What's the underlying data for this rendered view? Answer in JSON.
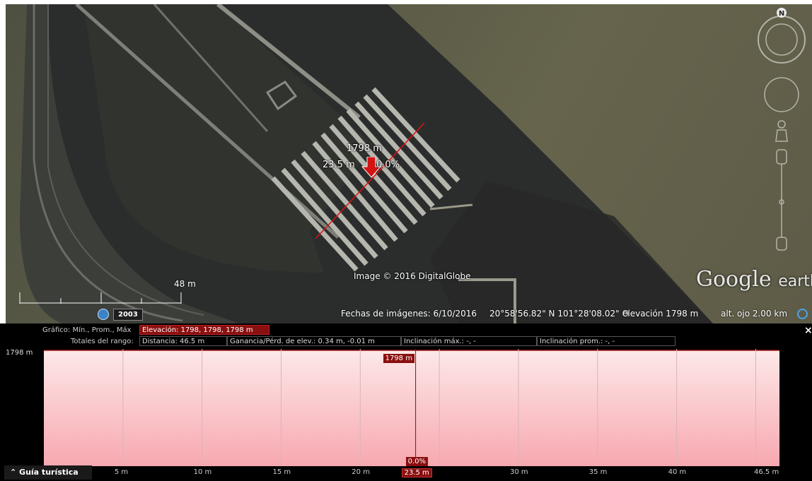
{
  "map": {
    "elevation_marker": "1798 m",
    "distance_marker": "23.5 m",
    "slope_marker": "0.0%",
    "image_credit": "Image © 2016 DigitalGlobe",
    "scale_label": "48 m",
    "history_year": "2003",
    "imagery_date": "Fechas de imágenes: 6/10/2016",
    "coordinates": "20°58'56.82\" N 101°28'08.02\" O",
    "elevation": "elevación  1798 m",
    "eye_alt": "alt. ojo   2.00 km",
    "logo_main": "Google",
    "logo_sub": "earth",
    "compass_north": "N",
    "colors": {
      "path_line": "#e01010",
      "marker_arrow": "#d41414"
    }
  },
  "profile": {
    "graph_label": "Gráfico: Mín., Prom., Máx",
    "elevation_summary": "Elevación: 1798, 1798, 1798 m",
    "range_totals_label": "Totales del rango:",
    "distance": "Distancia: 46.5 m",
    "gain_loss": "Ganancia/Pérd. de elev.: 0.34 m, -0.01 m",
    "max_slope": "Inclinación máx.: -, -",
    "avg_slope": "Inclinación prom.: -, -",
    "y_label": "1798 m",
    "cursor_elevation": "1798 m",
    "cursor_slope": "0.0%",
    "cursor_distance": "23.5 m",
    "close_label": "×",
    "tour_guide": "⌃ Guía turística",
    "colors": {
      "fill_top": "#fde8e8",
      "fill_bottom": "#f7a8b0",
      "line": "#a01818",
      "tag_bg": "#8a0f0f"
    }
  },
  "chart_data": {
    "type": "area",
    "x_ticks": [
      "5 m",
      "10 m",
      "15 m",
      "20 m",
      "30 m",
      "35 m",
      "40 m",
      "46.5 m"
    ],
    "x": [
      0,
      46.5
    ],
    "y": [
      1798,
      1798
    ],
    "xlim": [
      0,
      46.5
    ],
    "cursor_x": 23.5,
    "ylabel": "1798 m"
  }
}
